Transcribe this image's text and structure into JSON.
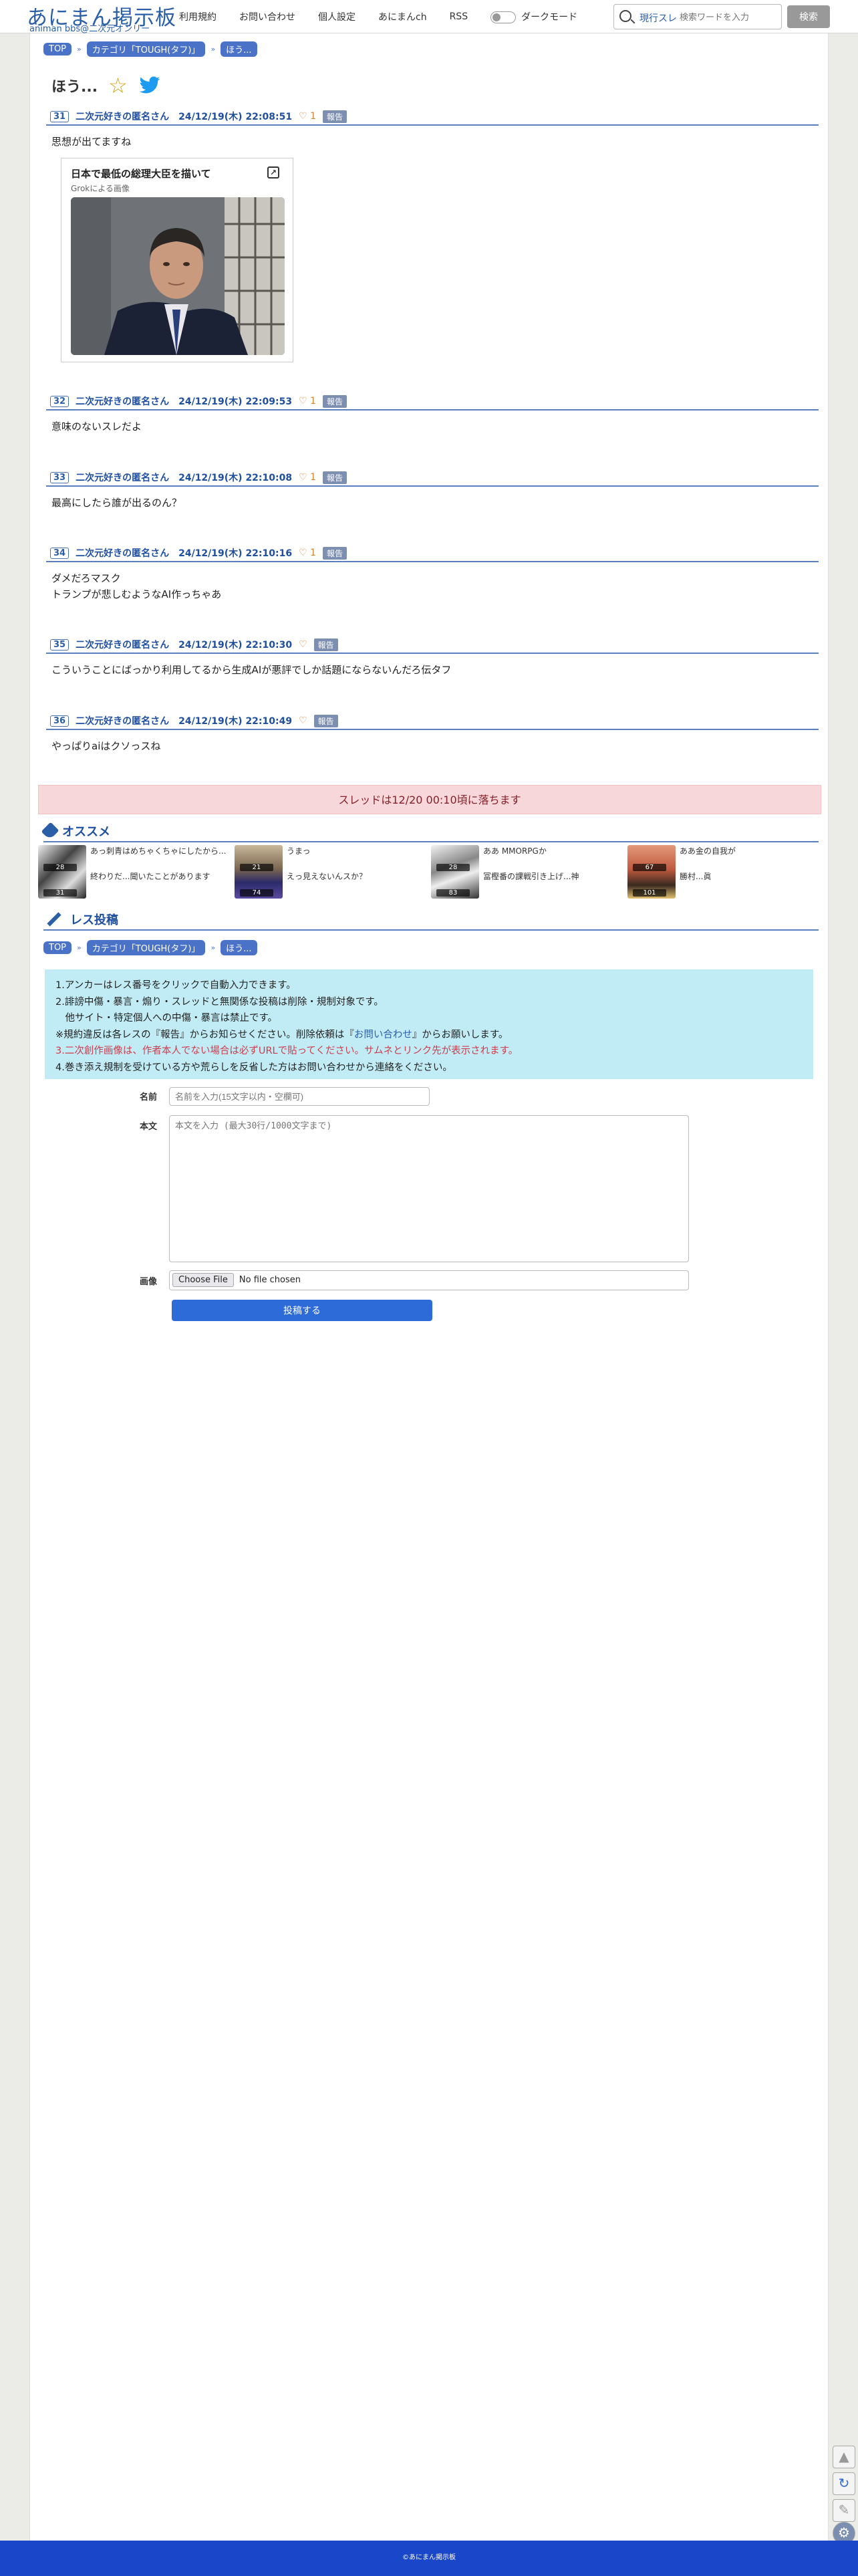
{
  "header": {
    "logo_title": "あにまん掲示板",
    "logo_sub": "animan bbs@二次元オンリー",
    "nav": [
      "利用規約",
      "お問い合わせ",
      "個人設定",
      "あにまんch",
      "RSS"
    ],
    "dark_mode": "ダークモード",
    "search_type": "現行スレ",
    "search_placeholder": "検索ワードを入力",
    "search_button": "検索"
  },
  "breadcrumb": {
    "top": "TOP",
    "category": "カテゴリ「TOUGH(タフ)」",
    "thread": "ほう..."
  },
  "thread": {
    "title": "ほう..."
  },
  "posts": [
    {
      "num": "31",
      "meta": "二次元好きの匿名さん　24/12/19(木) 22:08:51",
      "likes": "♡ 1",
      "report": "報告",
      "body": [
        "思想が出てますね"
      ]
    },
    {
      "num": "32",
      "meta": "二次元好きの匿名さん　24/12/19(木) 22:09:53",
      "likes": "♡ 1",
      "report": "報告",
      "body": [
        "意味のないスレだよ"
      ]
    },
    {
      "num": "33",
      "meta": "二次元好きの匿名さん　24/12/19(木) 22:10:08",
      "likes": "♡ 1",
      "report": "報告",
      "body": [
        "最高にしたら誰が出るのん？"
      ]
    },
    {
      "num": "34",
      "meta": "二次元好きの匿名さん　24/12/19(木) 22:10:16",
      "likes": "♡ 1",
      "report": "報告",
      "body": [
        "ダメだろマスク",
        "トランプが悲しむようなAI作っちゃあ"
      ]
    },
    {
      "num": "35",
      "meta": "二次元好きの匿名さん　24/12/19(木) 22:10:30",
      "likes": "♡",
      "report": "報告",
      "body": [
        "こういうことにばっかり利用してるから生成AIが悪評でしか話題にならないんだろ伝タフ"
      ]
    },
    {
      "num": "36",
      "meta": "二次元好きの匿名さん　24/12/19(木) 22:10:49",
      "likes": "♡",
      "report": "報告",
      "body": [
        "やっぱりaiはクソっスね"
      ]
    }
  ],
  "ai_card": {
    "title": "日本で最低の総理大臣を描いて",
    "sub": "Grokによる画像"
  },
  "expire_notice": "スレッドは12/20 00:10頃に落ちます",
  "recommend": {
    "heading": "オススメ",
    "items": [
      {
        "line1": "あっ刺青はめちゃくちゃにしたから...",
        "line2": "終わりだ...聞いたことがあります",
        "count": "31"
      },
      {
        "line1": "うまっ",
        "line2": "えっ見えないんスか？",
        "count": "74"
      },
      {
        "line1": "ああ MMORPGか",
        "line2": "冨樫番の課戦引き上げ...神",
        "count": "83"
      },
      {
        "line1": "ああ金の自我が",
        "line2": "勝村...眞",
        "count": "101"
      }
    ],
    "top_counts": [
      "28",
      "21",
      "28",
      "67"
    ]
  },
  "reply": {
    "heading": "レス投稿",
    "rules": [
      "1.アンカーはレス番号をクリックで自動入力できます。",
      "2.誹謗中傷・暴言・煽り・スレッドと無関係な投稿は削除・規制対象です。",
      "　他サイト・特定個人への中傷・暴言は禁止です。",
      "※規約違反は各レスの『報告』からお知らせください。削除依頼は『",
      "お問い合わせ",
      "』からお願いします。",
      "3.二次創作画像は、",
      "作者本人でない場合は必ずURLで貼ってください。サムネとリンク先が表示されます。",
      "4.巻き添え規制を受けている方や荒らしを反省した方はお問い合わせから連絡をください。"
    ],
    "name_label": "名前",
    "name_placeholder": "名前を入力(15文字以内・空欄可)",
    "body_label": "本文",
    "body_placeholder": "本文を入力 (最大30行/1000文字まで)",
    "image_label": "画像",
    "file_button": "Choose File",
    "file_status": "No file chosen",
    "submit": "投稿する"
  },
  "footer": {
    "copyright": "©あにまん掲示板"
  }
}
